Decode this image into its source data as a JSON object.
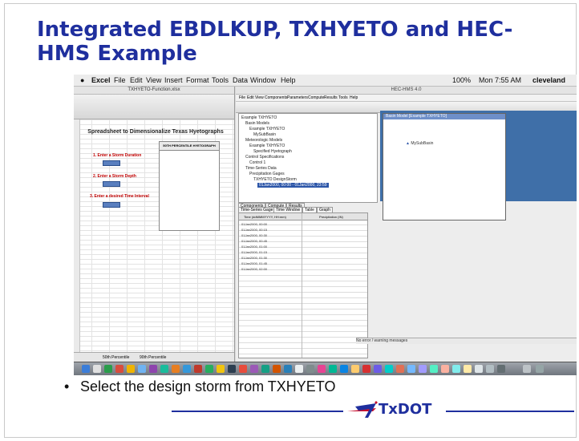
{
  "slide": {
    "title": "Integrated EBDLKUP, TXHYETO and HEC-HMS Example",
    "bullet": "Select the design storm from TXHYETO",
    "logo_text": "TxDOT",
    "accent_color": "#1f2f9e",
    "logo_swoosh_color": "#c8102e"
  },
  "mac_menubar": {
    "apple": "",
    "items": [
      "Excel",
      "File",
      "Edit",
      "View",
      "Insert",
      "Format",
      "Tools",
      "Data",
      "Window",
      "Help"
    ],
    "status": "100%",
    "clock": "Mon 7:55 AM",
    "user": "cleveland"
  },
  "excel": {
    "window_title": "TXHYETO-Function.xlsx",
    "sheet_heading": "Spreadsheet to Dimensionalize Texas Hyetographs",
    "step1": "1. Enter a Storm Duration",
    "step2": "2. Enter a Storm Depth",
    "step3": "3. Enter a desired Time Interval",
    "table_header": "50TH PERCENTILE HYETOGRAPH",
    "sheet_tabs": [
      "50th Percentile",
      "90th Percentile"
    ]
  },
  "hms": {
    "window_title": "HEC-HMS 4.0",
    "menus": [
      "File",
      "Edit",
      "View",
      "Components",
      "Parameters",
      "Compute",
      "Results",
      "Tools",
      "Help"
    ],
    "tree": [
      "Example TXHYETO",
      "Basin Models",
      "Example TXHYETO",
      "MySubBasin",
      "Meteorologic Models",
      "Example TXHYETO",
      "Specified Hyetograph",
      "Control Specifications",
      "Control 1",
      "Time-Series Data",
      "Precipitation Gages",
      "TXHYETO DesignStorm",
      "01Jan2000, 00:00 - 01Jan2000, 23:59"
    ],
    "tree_tabs": [
      "Components",
      "Compute",
      "Results"
    ],
    "data_tabs": [
      "Time-Series Gage",
      "Time Window",
      "Table",
      "Graph"
    ],
    "table_headers": [
      "Time (ddMMMYYYY, HH:mm)",
      "Precipitation (IN)"
    ],
    "table_times": [
      "01Jan2000, 00:00",
      "01Jan2000, 00:15",
      "01Jan2000, 00:30",
      "01Jan2000, 00:45",
      "01Jan2000, 01:00",
      "01Jan2000, 01:15",
      "01Jan2000, 01:30",
      "01Jan2000, 01:45",
      "01Jan2000, 02:00"
    ],
    "basin_window_title": "Basin Model [Example TXHYETO]",
    "subbasin_label": "MySubBasin",
    "status_text": "No error / warning messages"
  }
}
